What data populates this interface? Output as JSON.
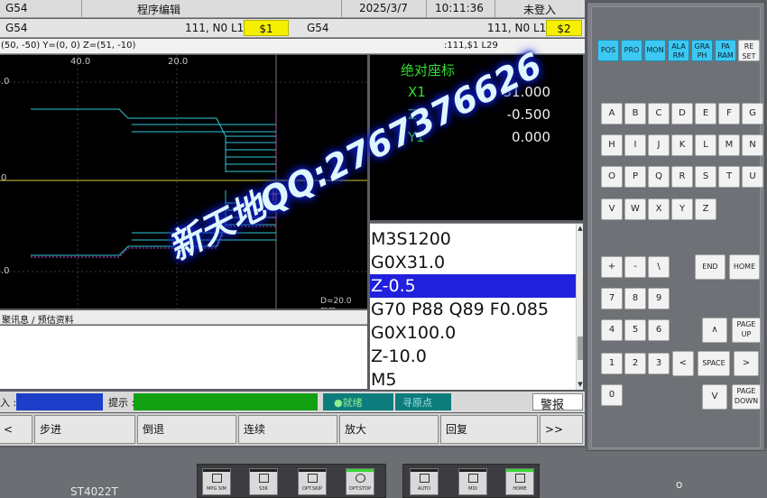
{
  "titlebar": {
    "channel_left": "G54",
    "mode": "程序编辑",
    "date": "2025/3/7",
    "time": "10:11:36",
    "login": "未登入"
  },
  "chanbar": {
    "ch1_label": "G54",
    "ch1_prog": "111, N0 L1",
    "ch1_tag": "$1",
    "ch2_label": "G54",
    "ch2_prog": "111, N0 L1",
    "ch2_tag": "$2"
  },
  "infobar": {
    "coords": "(50, -50) Y=(0, 0) Z=(51, -10)",
    "prog_ref": ":111,$1 L29"
  },
  "graph": {
    "tick_top_1": "40.0",
    "tick_top_2": "20.0",
    "tick_left_1": ".0",
    "tick_left_2": "0",
    "tick_left_3": ".0",
    "scale": "D=20.0 mm"
  },
  "abs_coords": {
    "title": "绝对座标",
    "axes": [
      {
        "name": "X1",
        "value": "31.000"
      },
      {
        "name": "Z1",
        "value": "-0.500"
      },
      {
        "name": "Y1",
        "value": "0.000"
      }
    ]
  },
  "program": {
    "lines": [
      {
        "text": "M3S1200"
      },
      {
        "text": "G0X31.0"
      },
      {
        "text": "Z-0.5"
      },
      {
        "text": "G70 P88 Q89 F0.085"
      },
      {
        "text": "G0X100.0"
      },
      {
        "text": "Z-10.0"
      },
      {
        "text": "M5"
      }
    ],
    "selected_index": 2
  },
  "messages": {
    "tab_label": "聚讯息 / 预估资料"
  },
  "status": {
    "input_label": "入 :",
    "hint_label": "提示 :",
    "ready": "●就绪",
    "home_search": "寻原点",
    "alarm": "警报"
  },
  "softkeys": {
    "prev": "<",
    "items": [
      "步进",
      "倒退",
      "连续",
      "放大",
      "回复"
    ],
    "next": ">>"
  },
  "dock": {
    "model": "ST4022T",
    "buttons": [
      {
        "label": "MPG SIM",
        "led": false
      },
      {
        "label": "S3K",
        "led": false
      },
      {
        "label": "OPT.SKIP",
        "led": false
      },
      {
        "label": "OPT.STOP",
        "led": true
      },
      {
        "label": "AUTO",
        "led": false
      },
      {
        "label": "MDI",
        "led": false
      },
      {
        "label": "HOME",
        "led": true
      }
    ],
    "indicator": "o"
  },
  "keypad": {
    "func_keys": [
      "POS",
      "PRO",
      "MON",
      "ALA RM",
      "GRA PH",
      "PA RAM",
      "RE SET"
    ],
    "letters": [
      "A",
      "B",
      "C",
      "D",
      "E",
      "F",
      "G",
      "H",
      "I",
      "J",
      "K",
      "L",
      "M",
      "N",
      "O",
      "P",
      "Q",
      "R",
      "S",
      "T",
      "U",
      "V",
      "W",
      "X",
      "Y",
      "Z"
    ],
    "sym": [
      "+",
      "-",
      "\\"
    ],
    "end": "END",
    "home": "HOME",
    "nums": [
      "7",
      "8",
      "9",
      "4",
      "5",
      "6",
      "1",
      "2",
      "3",
      "0"
    ],
    "up": "∧",
    "down": "V",
    "left": "<",
    "right": ">",
    "space": "SPACE",
    "page_up": "PAGE UP",
    "page_down": "PAGE DOWN"
  },
  "watermark": {
    "text": "新天地QQ:2767376626"
  },
  "colors": {
    "cyan_key": "#3cc8f2",
    "select_blue": "#2020dd",
    "ready_green": "#0a9a0a",
    "yellow_tag": "#f4f000"
  }
}
